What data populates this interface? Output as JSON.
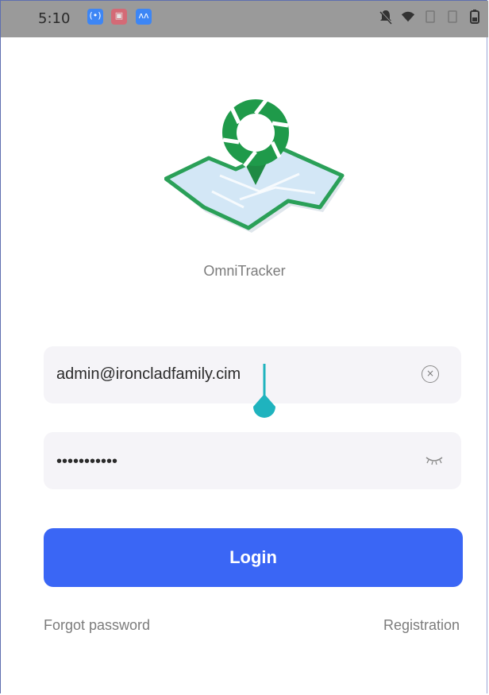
{
  "status_bar": {
    "time": "5:10",
    "apps": [
      "screencast-icon",
      "photo-icon",
      "mail-icon"
    ],
    "right_icons": [
      "bell-off-icon",
      "wifi-icon",
      "sim-icon",
      "sim-icon",
      "battery-icon"
    ]
  },
  "app": {
    "name": "OmniTracker",
    "colors": {
      "brand_green": "#1f9a4a",
      "map_blue": "#cfe3f3",
      "accent_blue": "#3a66f5",
      "cursor_teal": "#1fb3be"
    }
  },
  "form": {
    "email_value": "admin@ironcladfamily.cim",
    "password_value": "•••••••••••",
    "login_label": "Login",
    "forgot_label": "Forgot password",
    "register_label": "Registration"
  }
}
